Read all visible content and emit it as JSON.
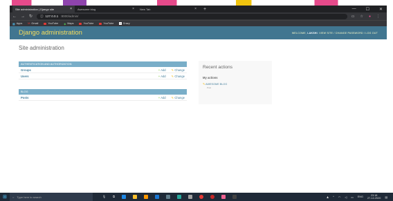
{
  "browser": {
    "tabs": [
      {
        "title": "Site administration | Django site",
        "active": true
      },
      {
        "title": "Awesome blog",
        "active": false
      },
      {
        "title": "New Tab",
        "active": false
      }
    ],
    "new_tab": "+",
    "url_host": "127.0.0.1",
    "url_path": ":8000/admin/",
    "window_controls": [
      "—",
      "☐",
      "✕"
    ],
    "bookmarks": [
      "Apps",
      "Gmail",
      "YouTube",
      "Maps",
      "YouTube",
      "YouTube",
      "Crazy"
    ]
  },
  "django": {
    "brand": "Django administration",
    "welcome": "WELCOME,",
    "username": "LAKSHI",
    "links": "VIEW SITE / CHANGE PASSWORD / LOG OUT",
    "page_title": "Site administration",
    "modules": [
      {
        "caption": "AUTHENTICATION AND AUTHORIZATION",
        "rows": [
          {
            "name": "Groups"
          },
          {
            "name": "Users"
          }
        ]
      },
      {
        "caption": "BLOG",
        "rows": [
          {
            "name": "Posts"
          }
        ]
      }
    ],
    "add_label": "Add",
    "change_label": "Change",
    "recent_title": "Recent actions",
    "my_actions": "My actions",
    "action_item": "AWESOME BLOG",
    "action_type": "Post"
  },
  "taskbar": {
    "search_placeholder": "Type here to search",
    "lang": "ENG",
    "time": "23:18",
    "date": "27-12-2020"
  },
  "colors": {
    "header": "#417690",
    "brand": "#f5dd5d",
    "caption": "#79aec8",
    "link": "#447e9b"
  }
}
